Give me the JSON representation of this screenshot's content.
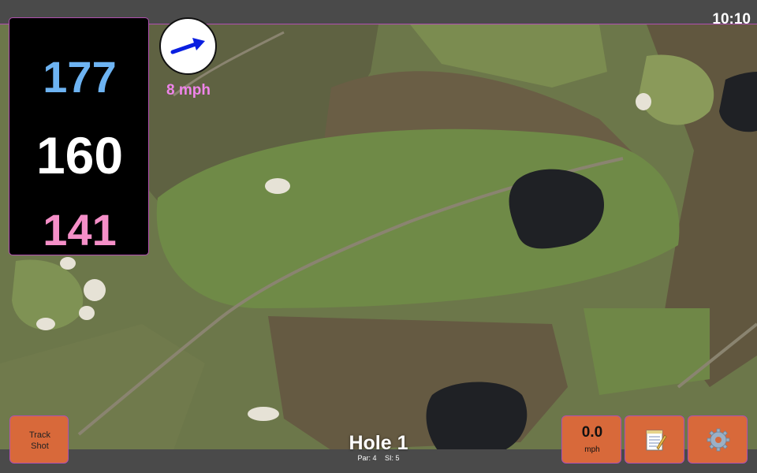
{
  "status": {
    "time": "10:10"
  },
  "distances": {
    "back": "177",
    "middle": "160",
    "front": "141",
    "back_color": "#6db3f2",
    "middle_color": "#ffffff",
    "front_color": "#f58fc8"
  },
  "wind": {
    "speed": "8 mph",
    "direction_icon": "arrow-right-icon",
    "arrow_color": "#0a1fe0"
  },
  "buttons": {
    "track_shot_line1": "Track",
    "track_shot_line2": "Shot",
    "speed_value": "0.0",
    "speed_unit": "mph",
    "notes_icon": "notepad-icon",
    "settings_icon": "gear-icon",
    "accent": "#d8693a"
  },
  "hole": {
    "title": "Hole 1",
    "par": "Par: 4",
    "si": "SI: 5"
  },
  "map": {
    "icon": "satellite-map"
  }
}
